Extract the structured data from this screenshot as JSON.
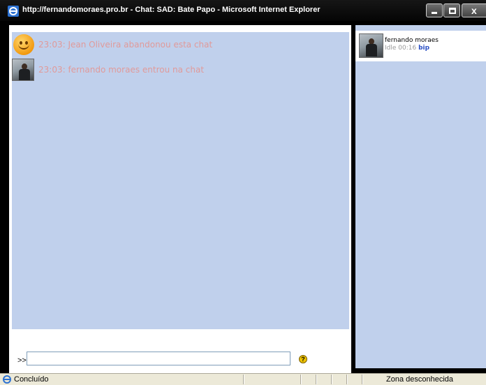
{
  "window": {
    "title": "http://fernandomoraes.pro.br - Chat: SAD: Bate Papo - Microsoft Internet Explorer"
  },
  "chat": {
    "messages": [
      {
        "time": "23:03:",
        "text": "Jean Oliveira abandonou esta chat",
        "icon": "smiley-icon"
      },
      {
        "time": "23:03:",
        "text": "fernando moraes entrou na chat",
        "icon": "user-avatar"
      }
    ],
    "prompt": ">>",
    "input_value": "",
    "help_icon": "?"
  },
  "users": [
    {
      "name": "fernando moraes",
      "idle": "Idle 00:16",
      "action": "bip"
    }
  ],
  "statusbar": {
    "text": "Concluído",
    "zone": "Zona desconhecida"
  },
  "colors": {
    "chat_bg": "#c0d0ec",
    "message_text": "#e09a9a",
    "link": "#2a4fc4"
  }
}
